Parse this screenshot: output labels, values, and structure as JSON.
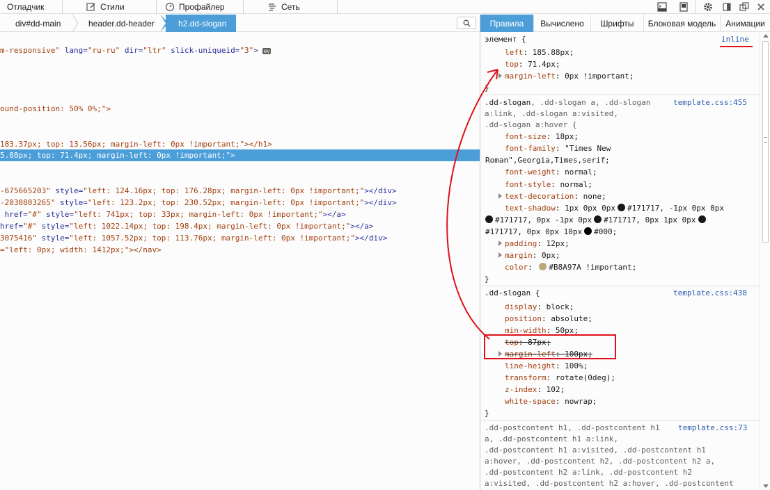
{
  "toolbar": {
    "tabs": [
      {
        "label": "Отладчик",
        "icon": "debugger-icon"
      },
      {
        "label": "Стили",
        "icon": "style-editor-icon"
      },
      {
        "label": "Профайлер",
        "icon": "profiler-icon"
      },
      {
        "label": "Сеть",
        "icon": "network-icon"
      }
    ],
    "right_icons": [
      "console-icon",
      "scratchpad-icon",
      "settings-icon",
      "dock-side-icon",
      "undock-icon",
      "close-icon"
    ]
  },
  "breadcrumbs": [
    "div#dd-main",
    "header.dd-header",
    "h2.dd-slogan"
  ],
  "sidebar_tabs": [
    "Правила",
    "Вычислено",
    "Шрифты",
    "Блоковая модель",
    "Анимации"
  ],
  "markup": {
    "line0": {
      "p1": "m-responsive\"",
      "a1": " lang=",
      "v1": "\"ru-ru\"",
      "a2": " dir=",
      "v2": "\"ltr\"",
      "a3": " slick-uniqueid=",
      "v3": "\"3\"",
      "end": ">",
      "badge": "ev"
    },
    "line1": "ound-position: 50% 0%;\">",
    "line2": "183.37px; top: 13.56px; margin-left: 0px !important;\"></h1>",
    "line3": "5.88px; top: 71.4px; margin-left: 0px !important;\">",
    "line4": {
      "v": "-675665203\"",
      "a": " style=",
      "s": "\"left: 124.16px; top: 176.28px; margin-left: 0px !important;\"",
      "end": "></div>"
    },
    "line5": {
      "v": "-2030803265\"",
      "a": " style=",
      "s": "\"left: 123.2px; top: 230.52px; margin-left: 0px !important;\"",
      "end": "></div>"
    },
    "line6": {
      "a0": " href=",
      "v": "\"#\"",
      "a": " style=",
      "s": "\"left: 741px; top: 33px; margin-left: 0px !important;\"",
      "end": "></a>"
    },
    "line7": {
      "a0": "href=",
      "v": "\"#\"",
      "a": " style=",
      "s": "\"left: 1022.14px; top: 198.4px; margin-left: 0px !important;\"",
      "end": "></a>"
    },
    "line8": {
      "v": "3075416\"",
      "a": " style=",
      "s": "\"left: 1057.52px; top: 113.76px; margin-left: 0px !important;\"",
      "end": "></div>"
    },
    "line9": "=\"left: 0px; width: 1412px;\"></nav>"
  },
  "rules": {
    "element": {
      "selector": "элемент {",
      "source": "inline",
      "props": [
        {
          "name": "left",
          "value": "185.88px;"
        },
        {
          "name": "top",
          "value": "71.4px;"
        },
        {
          "name": "margin-left",
          "value": "0px !important;"
        }
      ],
      "close": "}"
    },
    "rule455": {
      "sel1": ".dd-slogan",
      "sel1b": ", .dd-slogan a, .dd-slogan",
      "sel2": "a:link, .dd-slogan a:visited,",
      "sel3": ".dd-slogan a:hover {",
      "source": "template.css:455",
      "font_size": {
        "name": "font-size",
        "value": "18px;"
      },
      "font_family": {
        "name": "font-family",
        "value": "\"Times New"
      },
      "font_family_cont": "Roman\",Georgia,Times,serif;",
      "font_weight": {
        "name": "font-weight",
        "value": "normal;"
      },
      "font_style": {
        "name": "font-style",
        "value": "normal;"
      },
      "text_decoration": {
        "name": "text-decoration",
        "value": "none;"
      },
      "text_shadow": {
        "name": "text-shadow",
        "v1": "1px 0px 0px",
        "v2": "#171717, -1px 0px 0px"
      },
      "ts_line2": {
        "v1": "#171717, 0px -1px 0px",
        "v2": "#171717, 0px 1px 0px"
      },
      "ts_line3": {
        "v1": "#171717, 0px 0px 10px",
        "v2": "#000;"
      },
      "padding": {
        "name": "padding",
        "value": "12px;"
      },
      "margin": {
        "name": "margin",
        "value": "0px;"
      },
      "color": {
        "name": "color",
        "value": "#B8A97A !important;"
      },
      "close": "}",
      "swatch_dark": "#171717",
      "swatch_black": "#000000",
      "swatch_gold": "#B8A97A"
    },
    "rule438": {
      "selector": ".dd-slogan {",
      "source": "template.css:438",
      "props": [
        {
          "name": "display",
          "value": "block;"
        },
        {
          "name": "position",
          "value": "absolute;"
        },
        {
          "name": "min-width",
          "value": "50px;"
        },
        {
          "name": "top",
          "value": "87px;"
        },
        {
          "name": "margin-left",
          "value": "100px;"
        },
        {
          "name": "line-height",
          "value": "100%;"
        },
        {
          "name": "transform",
          "value": "rotate(0deg);"
        },
        {
          "name": "z-index",
          "value": "102;"
        },
        {
          "name": "white-space",
          "value": "nowrap;"
        }
      ],
      "close": "}"
    },
    "rule73": {
      "lines": [
        ".dd-postcontent h1, .dd-postcontent h1",
        "a, .dd-postcontent h1 a:link,",
        ".dd-postcontent h1 a:visited, .dd-postcontent h1",
        "a:hover, .dd-postcontent h2, .dd-postcontent h2 a,",
        ".dd-postcontent h2 a:link, .dd-postcontent h2",
        "a:visited, .dd-postcontent h2 a:hover, .dd-postcontent"
      ],
      "source": "template.css:73"
    }
  },
  "colors": {
    "accent": "#4c9ed9",
    "annotation": "#e0101a"
  }
}
